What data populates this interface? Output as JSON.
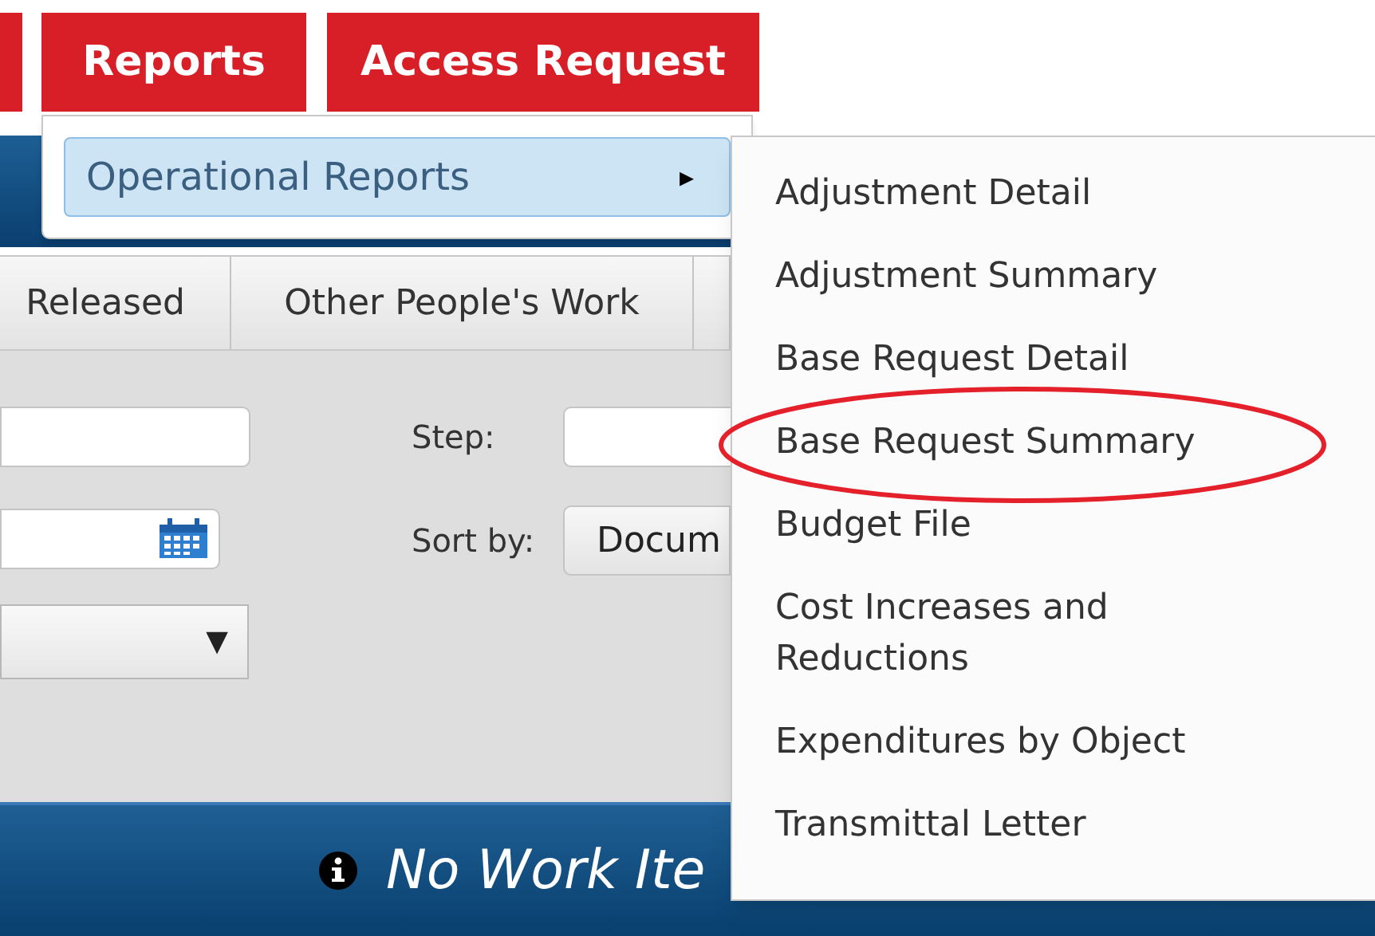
{
  "nav_tabs": [
    {
      "kind": "edge"
    },
    {
      "kind": "tab",
      "label": "Reports"
    },
    {
      "kind": "tab",
      "label": "Access Request"
    }
  ],
  "reports_menu": {
    "items": [
      {
        "label": "Operational Reports",
        "arrow": "▸",
        "highlighted": true
      }
    ]
  },
  "submenu": {
    "items": [
      {
        "label": "Adjustment Detail",
        "circled": false
      },
      {
        "label": "Adjustment Summary",
        "circled": false
      },
      {
        "label": "Base Request Detail",
        "circled": false
      },
      {
        "label": "Base Request Summary",
        "circled": true
      },
      {
        "label": "Budget File",
        "circled": false
      },
      {
        "label": "Cost Increases and Reductions",
        "circled": false
      },
      {
        "label": "Expenditures by Object",
        "circled": false
      },
      {
        "label": "Transmittal Letter",
        "circled": false
      }
    ]
  },
  "work_tabs": [
    {
      "kind": "tab",
      "label": "Released"
    },
    {
      "kind": "tab",
      "label": "Other People's Work"
    },
    {
      "kind": "edge"
    }
  ],
  "filters": {
    "step_label": "Step:",
    "sort_label": "Sort by:",
    "sort_value": "Docum",
    "select_caret": "▼"
  },
  "message": {
    "text": "No Work Ite"
  }
}
